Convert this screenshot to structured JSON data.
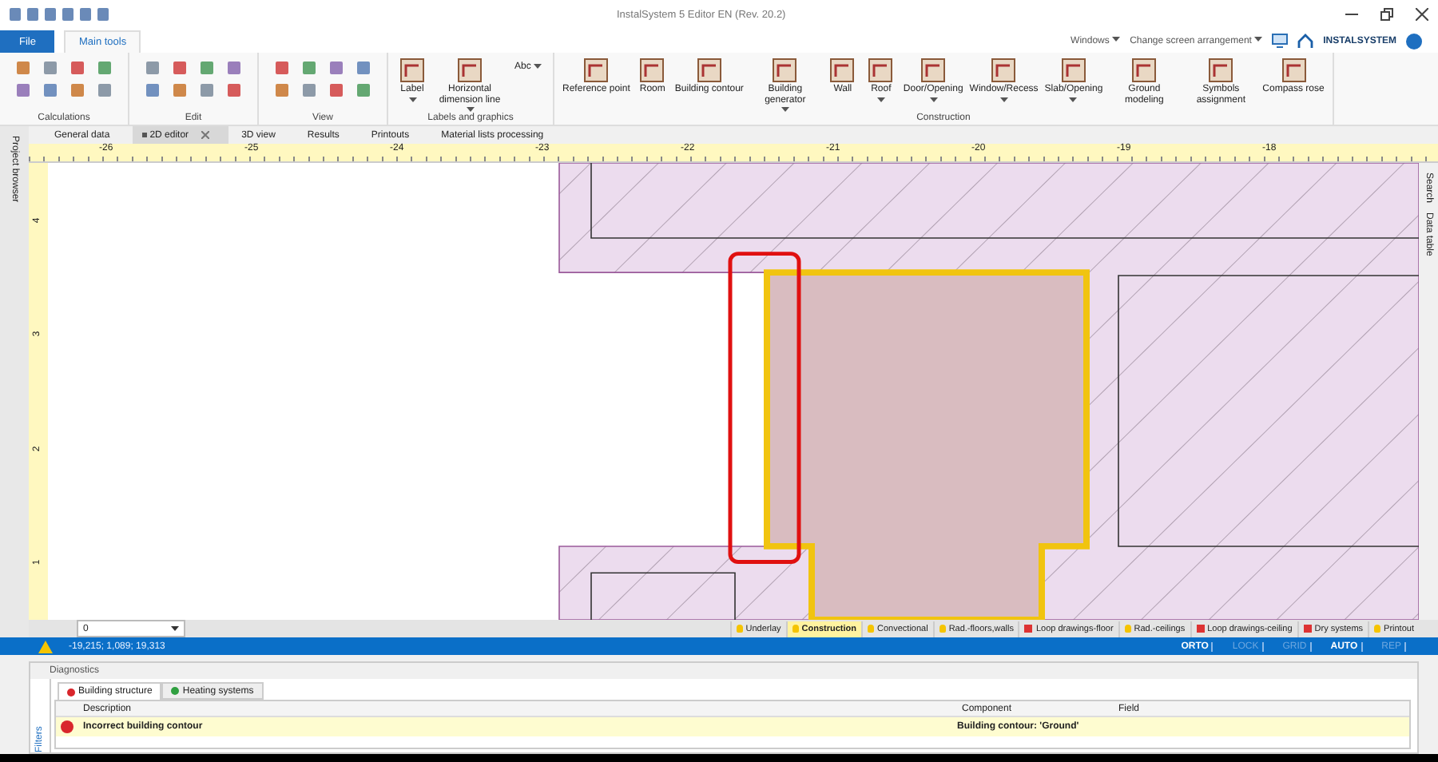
{
  "window": {
    "title": "InstalSystem 5 Editor EN (Rev. 20.2)"
  },
  "ribbon_tabs": [
    {
      "label": "File",
      "kind": "file",
      "selected": false
    },
    {
      "label": "Main tools",
      "kind": "tab",
      "selected": true
    }
  ],
  "ribbon_right": {
    "menus": [
      "Windows",
      "Change screen arrangement"
    ],
    "logo": "INSTALSYSTEM"
  },
  "ribbon_groups": [
    {
      "label": "Calculations",
      "kind": "icons"
    },
    {
      "label": "Edit",
      "kind": "icons"
    },
    {
      "label": "View",
      "kind": "icons"
    },
    {
      "label": "Labels and graphics",
      "kind": "buttons",
      "buttons": [
        {
          "label": "Label",
          "dropdown": true,
          "kind": "large"
        },
        {
          "label": "Horizontal dimension line",
          "dropdown": true,
          "kind": "large"
        },
        {
          "label": "Abc",
          "dropdown": true,
          "kind": "small"
        }
      ]
    },
    {
      "label": "Construction",
      "kind": "buttons",
      "buttons": [
        {
          "label": "Reference point",
          "dropdown": false,
          "kind": "large"
        },
        {
          "label": "Room",
          "dropdown": false,
          "kind": "large"
        },
        {
          "label": "Building contour",
          "dropdown": false,
          "kind": "large"
        },
        {
          "label": "Building generator",
          "dropdown": true,
          "kind": "large"
        },
        {
          "label": "Wall",
          "dropdown": false,
          "kind": "large"
        },
        {
          "label": "Roof",
          "dropdown": true,
          "kind": "large"
        },
        {
          "label": "Door/Opening",
          "dropdown": true,
          "kind": "large"
        },
        {
          "label": "Window/Recess",
          "dropdown": true,
          "kind": "large"
        },
        {
          "label": "Slab/Opening",
          "dropdown": true,
          "kind": "large"
        },
        {
          "label": "Ground modeling",
          "dropdown": false,
          "kind": "large"
        },
        {
          "label": "Symbols assignment",
          "dropdown": false,
          "kind": "large"
        },
        {
          "label": "Compass rose",
          "dropdown": false,
          "kind": "large"
        }
      ]
    }
  ],
  "side_panels": {
    "left": "Project browser",
    "right": [
      "Search",
      "Data table"
    ]
  },
  "document_tabs": [
    {
      "label": "General data",
      "selected": false,
      "modified": false
    },
    {
      "label": "2D editor",
      "selected": true,
      "modified": true
    },
    {
      "label": "3D view",
      "selected": false,
      "modified": false
    },
    {
      "label": "Results",
      "selected": false,
      "modified": false
    },
    {
      "label": "Printouts",
      "selected": false,
      "modified": false
    },
    {
      "label": "Material lists processing",
      "selected": false,
      "modified": false
    }
  ],
  "ruler": {
    "x_labels": [
      "-26",
      "-25",
      "-24",
      "-23",
      "-22",
      "-21",
      "-20",
      "-19",
      "-18"
    ],
    "y_labels": [
      "4",
      "3",
      "2",
      "1"
    ]
  },
  "layer": {
    "value": "0"
  },
  "layer_tabs": [
    {
      "label": "Underlay",
      "visible": true,
      "selected": false
    },
    {
      "label": "Construction",
      "visible": true,
      "selected": true
    },
    {
      "label": "Convectional",
      "visible": true,
      "selected": false
    },
    {
      "label": "Rad.-floors,walls",
      "visible": true,
      "selected": false
    },
    {
      "label": "Loop drawings-floor",
      "visible": false,
      "selected": false
    },
    {
      "label": "Rad.-ceilings",
      "visible": true,
      "selected": false
    },
    {
      "label": "Loop drawings-ceiling",
      "visible": false,
      "selected": false
    },
    {
      "label": "Dry systems",
      "visible": false,
      "selected": false
    },
    {
      "label": "Printout",
      "visible": true,
      "selected": false
    }
  ],
  "status_bar": {
    "coordinates": "-19,215; 1,089; 19,313",
    "modes": [
      {
        "label": "ORTO",
        "on": true
      },
      {
        "label": "LOCK",
        "on": false
      },
      {
        "label": "GRID",
        "on": false
      },
      {
        "label": "AUTO",
        "on": true
      },
      {
        "label": "REP",
        "on": false
      }
    ]
  },
  "diagnostics": {
    "title": "Diagnostics",
    "filters": "Filters",
    "tabs": [
      {
        "label": "Building structure",
        "selected": true,
        "kind": "error"
      },
      {
        "label": "Heating systems",
        "selected": false,
        "kind": "ok"
      }
    ],
    "columns": [
      "Description",
      "Component",
      "Field"
    ],
    "rows": [
      {
        "kind": "error",
        "description": "Incorrect building contour",
        "component": "Building contour: 'Ground'"
      }
    ]
  }
}
